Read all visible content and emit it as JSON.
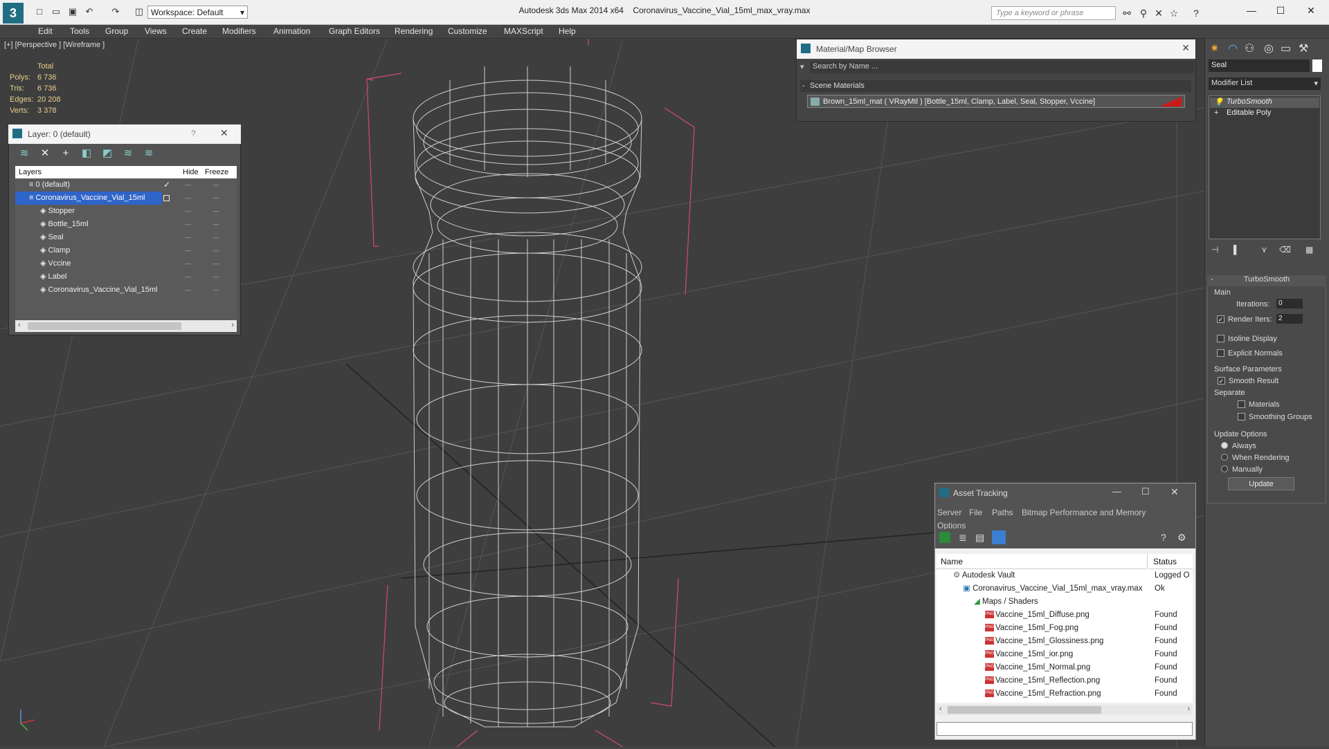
{
  "window": {
    "app_title": "Autodesk 3ds Max  2014 x64",
    "file_name": "Coronavirus_Vaccine_Vial_15ml_max_vray.max",
    "workspace": "Workspace: Default",
    "search_placeholder": "Type a keyword or phrase"
  },
  "menu": [
    "Edit",
    "Tools",
    "Group",
    "Views",
    "Create",
    "Modifiers",
    "Animation",
    "Graph Editors",
    "Rendering",
    "Customize",
    "MAXScript",
    "Help"
  ],
  "viewport": {
    "label": "[+] [Perspective ] [Wireframe ]",
    "stats": {
      "header": "Total",
      "rows": [
        {
          "k": "Polys:",
          "v": "6 736"
        },
        {
          "k": "Tris:",
          "v": "6 736"
        },
        {
          "k": "Edges:",
          "v": "20 208"
        },
        {
          "k": "Verts:",
          "v": "3 378"
        }
      ]
    }
  },
  "layer_panel": {
    "title": "Layer: 0 (default)",
    "help": "?",
    "col_layers": "Layers",
    "col_hide": "Hide",
    "col_freeze": "Freeze",
    "rows": [
      {
        "name": "0 (default)"
      },
      {
        "name": "Coronavirus_Vaccine_Vial_15ml"
      },
      {
        "name": "Stopper"
      },
      {
        "name": "Bottle_15ml"
      },
      {
        "name": "Seal"
      },
      {
        "name": "Clamp"
      },
      {
        "name": "Vccine"
      },
      {
        "name": "Label"
      },
      {
        "name": "Coronavirus_Vaccine_Vial_15ml"
      }
    ]
  },
  "material_browser": {
    "title": "Material/Map Browser",
    "search_placeholder": "Search by Name ...",
    "section": "Scene Materials",
    "item": "Brown_15ml_mat  ( VRayMtl )  [Bottle_15ml, Clamp, Label, Seal, Stopper, Vccine]",
    "swatch_color": "#cc1a1a"
  },
  "command_panel": {
    "object_name": "Seal",
    "modifier_list": "Modifier List",
    "stack": [
      "TurboSmooth",
      "Editable Poly"
    ],
    "rollout_title": "TurboSmooth",
    "main_label": "Main",
    "iterations_label": "Iterations:",
    "iterations_value": "0",
    "render_iters_label": "Render Iters:",
    "render_iters_value": "2",
    "isoline_label": "Isoline Display",
    "explicit_label": "Explicit Normals",
    "surface_label": "Surface Parameters",
    "smooth_result_label": "Smooth Result",
    "separate_label": "Separate",
    "materials_label": "Materials",
    "smoothing_groups_label": "Smoothing Groups",
    "update_options_label": "Update Options",
    "always_label": "Always",
    "when_rendering_label": "When Rendering",
    "manually_label": "Manually",
    "update_button": "Update"
  },
  "asset_tracking": {
    "title": "Asset Tracking",
    "menu": [
      "Server",
      "File",
      "Paths",
      "Bitmap Performance and Memory",
      "Options"
    ],
    "col_name": "Name",
    "col_status": "Status",
    "rows": [
      {
        "name": "Autodesk Vault",
        "status": "Logged O",
        "indent": 1
      },
      {
        "name": "Coronavirus_Vaccine_Vial_15ml_max_vray.max",
        "status": "Ok",
        "indent": 2
      },
      {
        "name": "Maps / Shaders",
        "status": "",
        "indent": 3
      },
      {
        "name": "Vaccine_15ml_Diffuse.png",
        "status": "Found",
        "indent": 4
      },
      {
        "name": "Vaccine_15ml_Fog.png",
        "status": "Found",
        "indent": 4
      },
      {
        "name": "Vaccine_15ml_Glossiness.png",
        "status": "Found",
        "indent": 4
      },
      {
        "name": "Vaccine_15ml_ior.png",
        "status": "Found",
        "indent": 4
      },
      {
        "name": "Vaccine_15ml_Normal.png",
        "status": "Found",
        "indent": 4
      },
      {
        "name": "Vaccine_15ml_Reflection.png",
        "status": "Found",
        "indent": 4
      },
      {
        "name": "Vaccine_15ml_Refraction.png",
        "status": "Found",
        "indent": 4
      }
    ]
  }
}
